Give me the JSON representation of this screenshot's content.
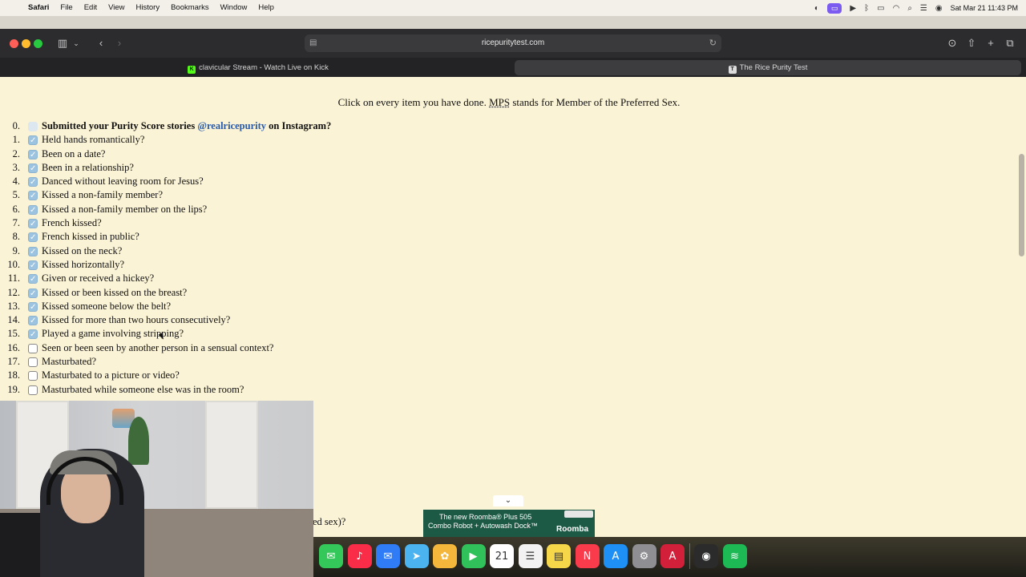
{
  "menubar": {
    "app_name": "Safari",
    "menus": [
      "File",
      "Edit",
      "View",
      "History",
      "Bookmarks",
      "Window",
      "Help"
    ],
    "datetime": "Sat Mar 21  11:43 PM"
  },
  "browser": {
    "url": "ricepuritytest.com",
    "tabs": [
      {
        "title": "clavicular Stream - Watch Live on Kick",
        "favicon": "K",
        "active": false
      },
      {
        "title": "The Rice Purity Test",
        "favicon": "T",
        "active": true
      }
    ]
  },
  "page": {
    "instructions_before": "Click on every item you have done. ",
    "instructions_abbr": "MPS",
    "instructions_after": " stands for Member of the Preferred Sex.",
    "questions": [
      {
        "num": "0.",
        "pre": "Submitted your Purity Score stories ",
        "link": "@realricepurity",
        "post": " on Instagram?",
        "bold": true,
        "state": "faint"
      },
      {
        "num": "1.",
        "text": "Held hands romantically?",
        "state": "checked"
      },
      {
        "num": "2.",
        "text": "Been on a date?",
        "state": "checked"
      },
      {
        "num": "3.",
        "text": "Been in a relationship?",
        "state": "checked"
      },
      {
        "num": "4.",
        "text": "Danced without leaving room for Jesus?",
        "state": "checked"
      },
      {
        "num": "5.",
        "text": "Kissed a non-family member?",
        "state": "checked"
      },
      {
        "num": "6.",
        "text": "Kissed a non-family member on the lips?",
        "state": "checked"
      },
      {
        "num": "7.",
        "text": "French kissed?",
        "state": "checked"
      },
      {
        "num": "8.",
        "text": "French kissed in public?",
        "state": "checked"
      },
      {
        "num": "9.",
        "text": "Kissed on the neck?",
        "state": "checked"
      },
      {
        "num": "10.",
        "text": "Kissed horizontally?",
        "state": "checked"
      },
      {
        "num": "11.",
        "text": "Given or received a hickey?",
        "state": "checked"
      },
      {
        "num": "12.",
        "text": "Kissed or been kissed on the breast?",
        "state": "checked"
      },
      {
        "num": "13.",
        "text": "Kissed someone below the belt?",
        "state": "checked"
      },
      {
        "num": "14.",
        "text": "Kissed for more than two hours consecutively?",
        "state": "checked"
      },
      {
        "num": "15.",
        "text": "Played a game involving stripping?",
        "state": "checked"
      },
      {
        "num": "16.",
        "text": "Seen or been seen by another person in a sensual context?",
        "state": "unchecked"
      },
      {
        "num": "17.",
        "text": "Masturbated?",
        "state": "unchecked"
      },
      {
        "num": "18.",
        "text": "Masturbated to a picture or video?",
        "state": "unchecked"
      },
      {
        "num": "19.",
        "text": "Masturbated while someone else was in the room?",
        "state": "unchecked"
      }
    ],
    "partial_text": "ed sex)?"
  },
  "ad": {
    "line1": "The new Roomba® Plus 505",
    "line2": "Combo Robot + Autowash Dock™",
    "brand": "Roomba"
  },
  "dock_apps": [
    {
      "name": "messages-icon",
      "color": "#34c759",
      "glyph": "✉"
    },
    {
      "name": "music-icon",
      "color": "#fa2d48",
      "glyph": "♪"
    },
    {
      "name": "mail-icon",
      "color": "#2f7cf6",
      "glyph": "✉"
    },
    {
      "name": "maps-icon",
      "color": "#4bb3f0",
      "glyph": "➤"
    },
    {
      "name": "photos-icon",
      "color": "#f5b73b",
      "glyph": "✿"
    },
    {
      "name": "facetime-icon",
      "color": "#30c15a",
      "glyph": "▶"
    },
    {
      "name": "calendar-icon",
      "color": "#ffffff",
      "glyph": "21"
    },
    {
      "name": "reminders-icon",
      "color": "#f2f2f2",
      "glyph": "☰"
    },
    {
      "name": "notes-icon",
      "color": "#f7d74a",
      "glyph": "▤"
    },
    {
      "name": "news-icon",
      "color": "#fa3b4b",
      "glyph": "N"
    },
    {
      "name": "app-store-icon",
      "color": "#1e90f5",
      "glyph": "A"
    },
    {
      "name": "settings-icon",
      "color": "#8e8e93",
      "glyph": "⚙"
    },
    {
      "name": "acrobat-icon",
      "color": "#d3203a",
      "glyph": "A"
    },
    {
      "name": "obs-icon",
      "color": "#2b2b2b",
      "glyph": "◉"
    },
    {
      "name": "spotify-icon",
      "color": "#1db954",
      "glyph": "≋"
    }
  ],
  "colors": {
    "page_bg": "#fbf3d5",
    "checked": "#9cc3e0",
    "link": "#2a5aa8"
  }
}
